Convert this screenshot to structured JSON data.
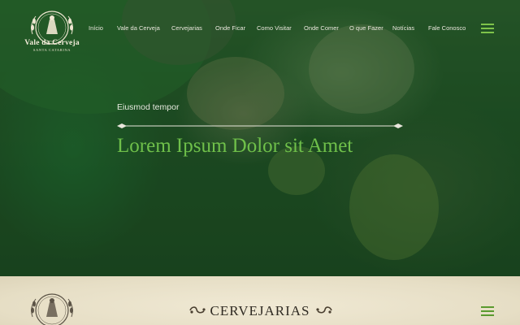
{
  "brand": {
    "title": "Vale da Cerveja",
    "subtitle": "SANTA CATARINA"
  },
  "nav": {
    "items": [
      {
        "label": "Início"
      },
      {
        "label": "Vale da Cerveja"
      },
      {
        "label": "Cervejarias"
      },
      {
        "label": "Onde Ficar"
      },
      {
        "label": "Como Visitar"
      },
      {
        "label": "Onde Comer"
      },
      {
        "label": "O que Fazer"
      },
      {
        "label": "Notícias"
      },
      {
        "label": "Fale Conosco"
      }
    ],
    "menu_icon": "hamburger-icon"
  },
  "hero": {
    "eyebrow": "Eiusmod tempor",
    "headline": "Lorem Ipsum Dolor sit Amet"
  },
  "section": {
    "title": "CERVEJARIAS",
    "menu_icon": "hamburger-icon"
  },
  "colors": {
    "accent_green": "#6fc04a",
    "hero_overlay": "#16481e",
    "section_background": "#ebe3cc",
    "section_text": "#2f2a22"
  }
}
